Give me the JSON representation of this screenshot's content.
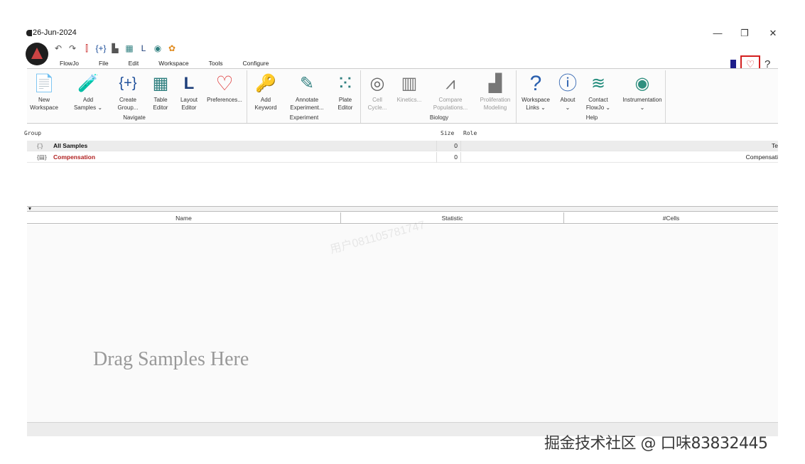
{
  "titlebar": {
    "date": "26-Jun-2024",
    "minimize": "—",
    "restore": "❐",
    "close": "✕"
  },
  "menu": {
    "items": [
      "FlowJo",
      "File",
      "Edit",
      "Workspace",
      "Tools",
      "Configure"
    ]
  },
  "ribbon": {
    "buttons": [
      {
        "key": "new-workspace",
        "icon": "📄",
        "label1": "New",
        "label2": "Workspace",
        "icon_color": "#3c9d3c"
      },
      {
        "key": "add-samples",
        "icon": "🧪",
        "label1": "Add",
        "label2": "Samples ⌄",
        "icon_color": "#2d5fae"
      },
      {
        "key": "create-group",
        "icon": "{+}",
        "label1": "Create",
        "label2": "Group...",
        "icon_color": "#1e4f9a"
      },
      {
        "key": "table-editor",
        "icon": "▦",
        "label1": "Table",
        "label2": "Editor",
        "icon_color": "#2f7f7f"
      },
      {
        "key": "layout-editor",
        "icon": "L",
        "label1": "Layout",
        "label2": "Editor",
        "icon_color": "#1e3f7a"
      },
      {
        "key": "preferences",
        "icon": "♡",
        "label1": "Preferences...",
        "label2": "",
        "icon_color": "#d33"
      },
      {
        "key": "add-keyword",
        "icon": "🔑",
        "label1": "Add",
        "label2": "Keyword",
        "icon_color": "#2a5a8a"
      },
      {
        "key": "annotate-experiment",
        "icon": "✎",
        "label1": "Annotate",
        "label2": "Experiment...",
        "icon_color": "#2f7f7f"
      },
      {
        "key": "plate-editor",
        "icon": "⁙",
        "label1": "Plate",
        "label2": "Editor",
        "icon_color": "#2f7f7f"
      },
      {
        "key": "cell-cycle",
        "icon": "◎",
        "label1": "Cell",
        "label2": "Cycle...",
        "icon_color": "#666"
      },
      {
        "key": "kinetics",
        "icon": "▥",
        "label1": "Kinetics...",
        "label2": "",
        "icon_color": "#777"
      },
      {
        "key": "compare-populations",
        "icon": "⩘",
        "label1": "Compare",
        "label2": "Populations...",
        "icon_color": "#777"
      },
      {
        "key": "proliferation-modeling",
        "icon": "▟",
        "label1": "Proliferation",
        "label2": "Modeling",
        "icon_color": "#777"
      },
      {
        "key": "workspace-links",
        "icon": "?",
        "label1": "Workspace",
        "label2": "Links ⌄",
        "icon_color": "#2a5fae"
      },
      {
        "key": "about",
        "icon": "ⓘ",
        "label1": "About",
        "label2": "⌄",
        "icon_color": "#2a5fae"
      },
      {
        "key": "contact-flowjo",
        "icon": "≋",
        "label1": "Contact",
        "label2": "FlowJo ⌄",
        "icon_color": "#1e8a7a"
      },
      {
        "key": "instrumentation",
        "icon": "◉",
        "label1": "Instrumentation",
        "label2": "⌄",
        "icon_color": "#2f8f7f"
      }
    ],
    "groups": [
      "Navigate",
      "Experiment",
      "Biology",
      "Help"
    ]
  },
  "samples": {
    "headers": {
      "group": "Group",
      "size": "Size",
      "role": "Role"
    },
    "rows": [
      {
        "icon": "{⁚}",
        "name": "All Samples",
        "size": "0",
        "role": "Te",
        "name_color": "#111"
      },
      {
        "icon": "{▤}",
        "name": "Compensation",
        "size": "0",
        "role": "Compensati",
        "name_color": "#b02020"
      }
    ]
  },
  "stats": {
    "headers": [
      "Name",
      "Statistic",
      "#Cells"
    ]
  },
  "drop_text": "Drag Samples Here",
  "watermark": "掘金技术社区 @ 口味83832445",
  "faint_watermark": "用户081105781747"
}
